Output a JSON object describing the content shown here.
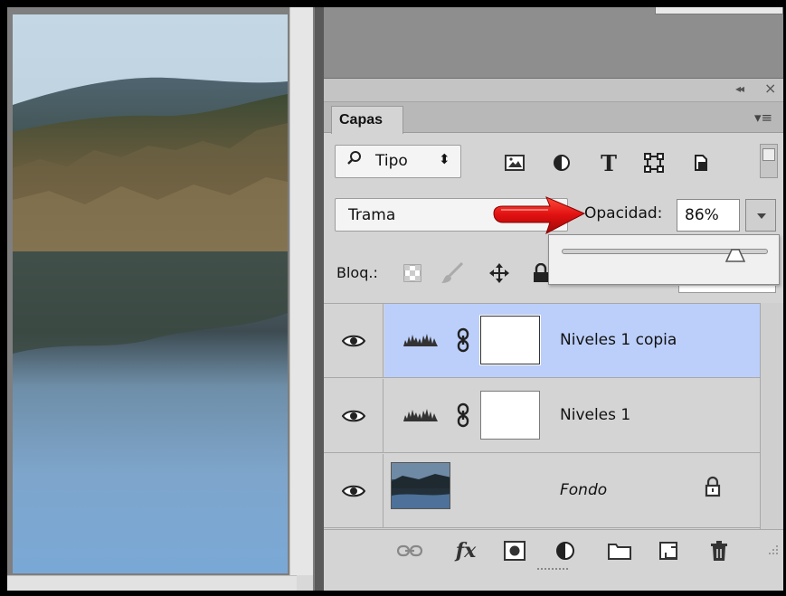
{
  "panel": {
    "tab_label": "Capas",
    "collapse_glyph": "«",
    "close_glyph": "×",
    "menu_glyph": "▾≡"
  },
  "filter": {
    "search_glyph": "⌕",
    "kind_label": "Tipo",
    "stepper_glyph": "⬍"
  },
  "blend": {
    "mode_label": "Trama",
    "opacity_label": "Opacidad:",
    "opacity_value": "86%"
  },
  "locks": {
    "label": "Bloq.:"
  },
  "layers": [
    {
      "name": "Niveles 1 copia",
      "selected": true,
      "type": "adjustment"
    },
    {
      "name": "Niveles 1",
      "selected": false,
      "type": "adjustment"
    },
    {
      "name": "Fondo",
      "selected": false,
      "type": "image",
      "locked": true
    }
  ],
  "colors": {
    "selection": "#bccffa",
    "arrow": "#e01010",
    "panel_bg": "#d4d4d4"
  }
}
